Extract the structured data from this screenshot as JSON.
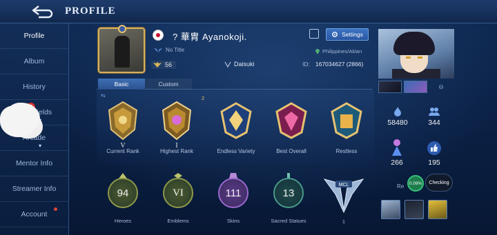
{
  "header": {
    "title": "PROFILE",
    "back_icon": "back-arrow-icon"
  },
  "sidebar": {
    "items": [
      {
        "label": "Profile",
        "active": true
      },
      {
        "label": "Album"
      },
      {
        "label": "History"
      },
      {
        "label": "Battlefields",
        "badge": "7"
      },
      {
        "label": "Arcade"
      },
      {
        "label": "Mentor Info"
      },
      {
        "label": "Streamer Info"
      },
      {
        "label": "Account",
        "dot": true
      }
    ]
  },
  "profile": {
    "name": "? 華胄 Ayanokoji.",
    "title": "No Title",
    "bp": "56",
    "squad": "Daisuki",
    "location": "Philippines/Aklan",
    "id_label": "ID:",
    "id_value": "167034627 (2866)",
    "settings_label": "Settings"
  },
  "tabs": [
    {
      "label": "Basic",
      "active": true
    },
    {
      "label": "Custom"
    }
  ],
  "medals": [
    {
      "label": "Current Rank",
      "sub": "V"
    },
    {
      "label": "Highest Rank",
      "sub": "I",
      "count": "2"
    },
    {
      "label": "Endless Variety"
    },
    {
      "label": "Best Overall"
    },
    {
      "label": "Restless"
    }
  ],
  "stats": [
    {
      "value": "94",
      "label": "Heroes",
      "color": "#b9c36a"
    },
    {
      "value": "VI",
      "label": "Emblems",
      "color": "#b9c36a"
    },
    {
      "value": "111",
      "label": "Skins",
      "color": "#b48ad8"
    },
    {
      "value": "13",
      "label": "Sacred Statues",
      "color": "#6fc0b0"
    },
    {
      "value": "1",
      "label": ""
    }
  ],
  "right": {
    "popularity": "58480",
    "followers": "344",
    "likes_left": "266",
    "likes": "195",
    "progress": "0.09%",
    "checking": "Checking",
    "rec_label": "Re"
  },
  "colors": {
    "accent": "#3d74c4",
    "gold": "#d4b160",
    "badge_red": "#d9322b"
  }
}
